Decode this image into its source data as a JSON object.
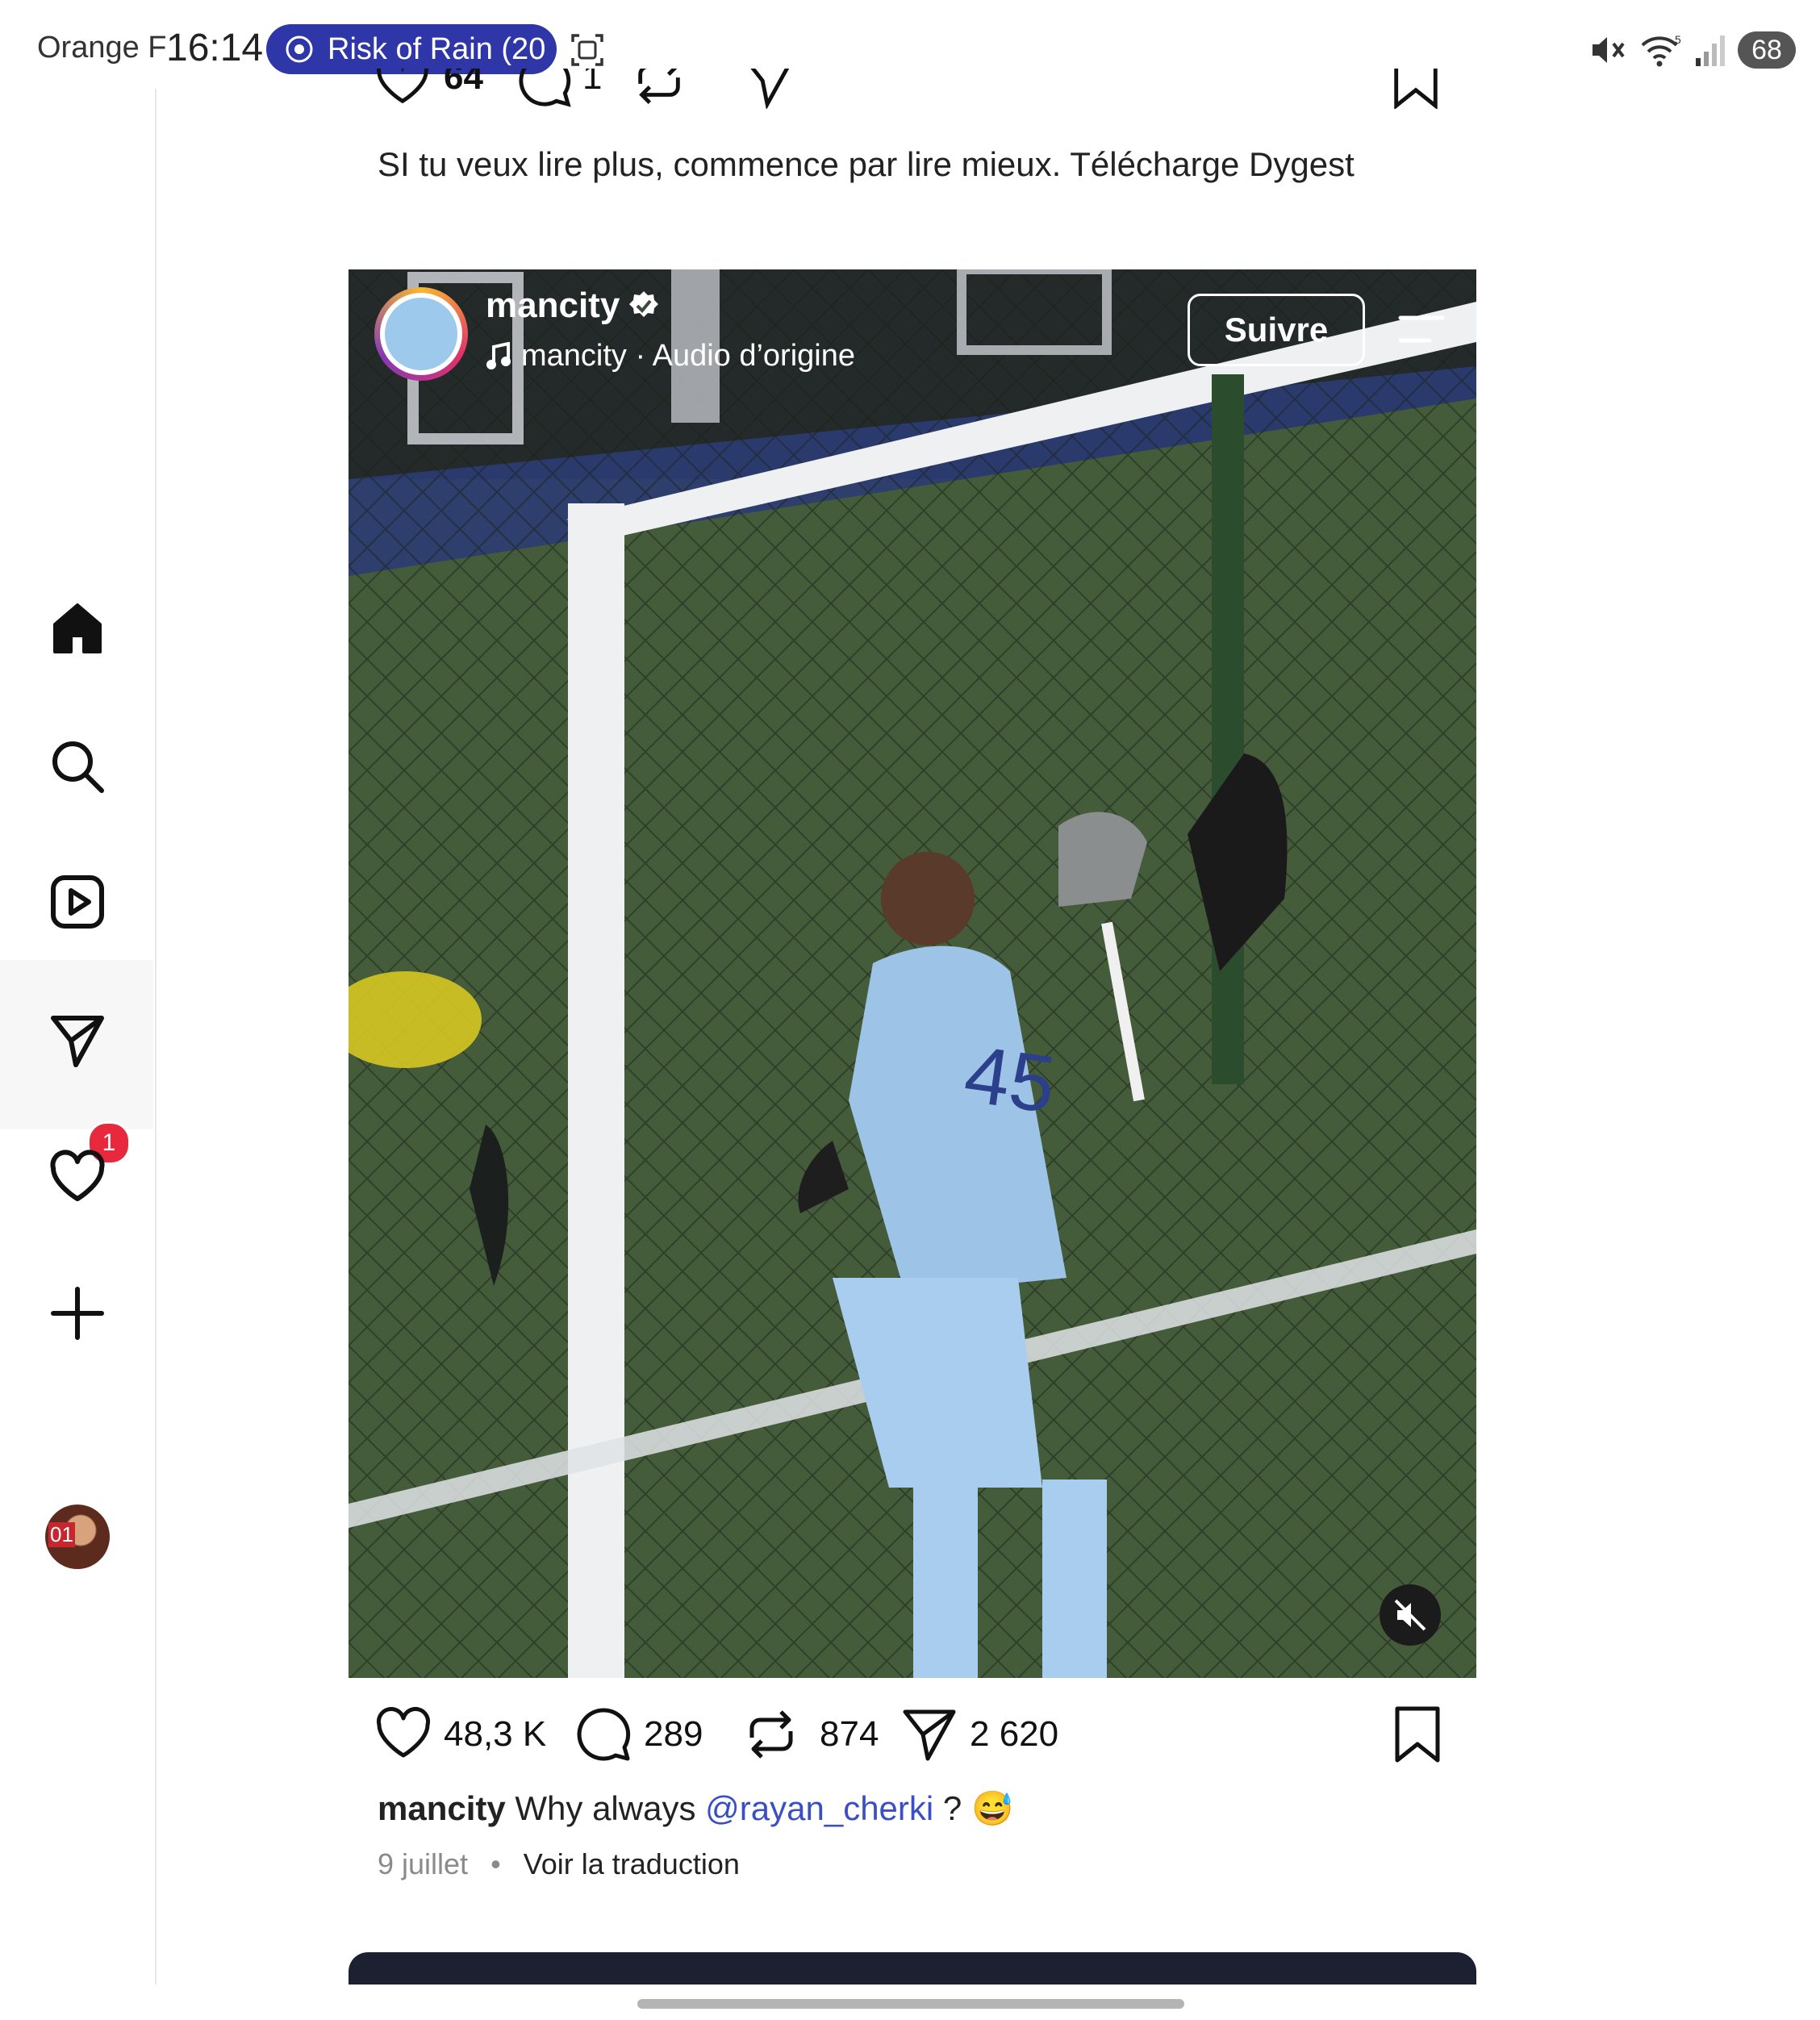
{
  "status_bar": {
    "carrier": "Orange F",
    "time": "16:14",
    "media_title": "Risk of Rain (20",
    "battery": "68",
    "signal_label": "5"
  },
  "nav": {
    "items": [
      {
        "icon": "home-icon"
      },
      {
        "icon": "search-icon"
      },
      {
        "icon": "reels-icon"
      },
      {
        "icon": "messages-icon",
        "badge": "1"
      },
      {
        "icon": "heart-icon"
      },
      {
        "icon": "plus-icon"
      },
      {
        "icon": "avatar",
        "avatar_text": "01"
      }
    ]
  },
  "previous_post": {
    "like_count": "64",
    "comment_count": "1",
    "caption": "SI tu veux lire plus, commence par lire mieux. Télécharge Dygest"
  },
  "reel": {
    "username": "mancity",
    "verified": true,
    "audio": "mancity · Audio d’origine",
    "follow_label": "Suivre",
    "colors": {
      "pitch": "#3e5637",
      "kit": "#9dc3e6"
    }
  },
  "actions": {
    "likes": "48,3 K",
    "comments": "289",
    "reposts": "874",
    "shares": "2 620"
  },
  "caption": {
    "user": "mancity",
    "text_before": "Why always",
    "mention": "@rayan_cherki",
    "text_after": "?",
    "emoji": "😅"
  },
  "meta": {
    "date": "9 juillet",
    "separator": "•",
    "translate": "Voir la traduction"
  }
}
